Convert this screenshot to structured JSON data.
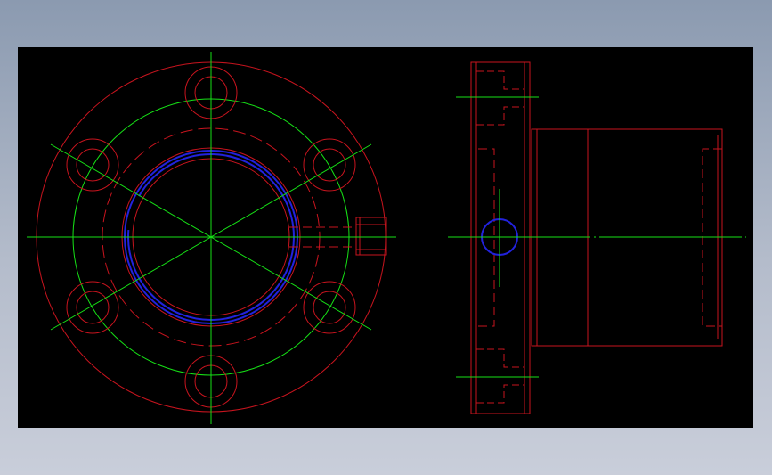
{
  "drawing": {
    "background_color": "#000000",
    "line_colors": {
      "outline": "#c8141e",
      "centerline": "#16e016",
      "detail": "#2222dd"
    },
    "views": [
      {
        "name": "front-view-flange"
      },
      {
        "name": "side-view-flange-nut"
      }
    ]
  }
}
